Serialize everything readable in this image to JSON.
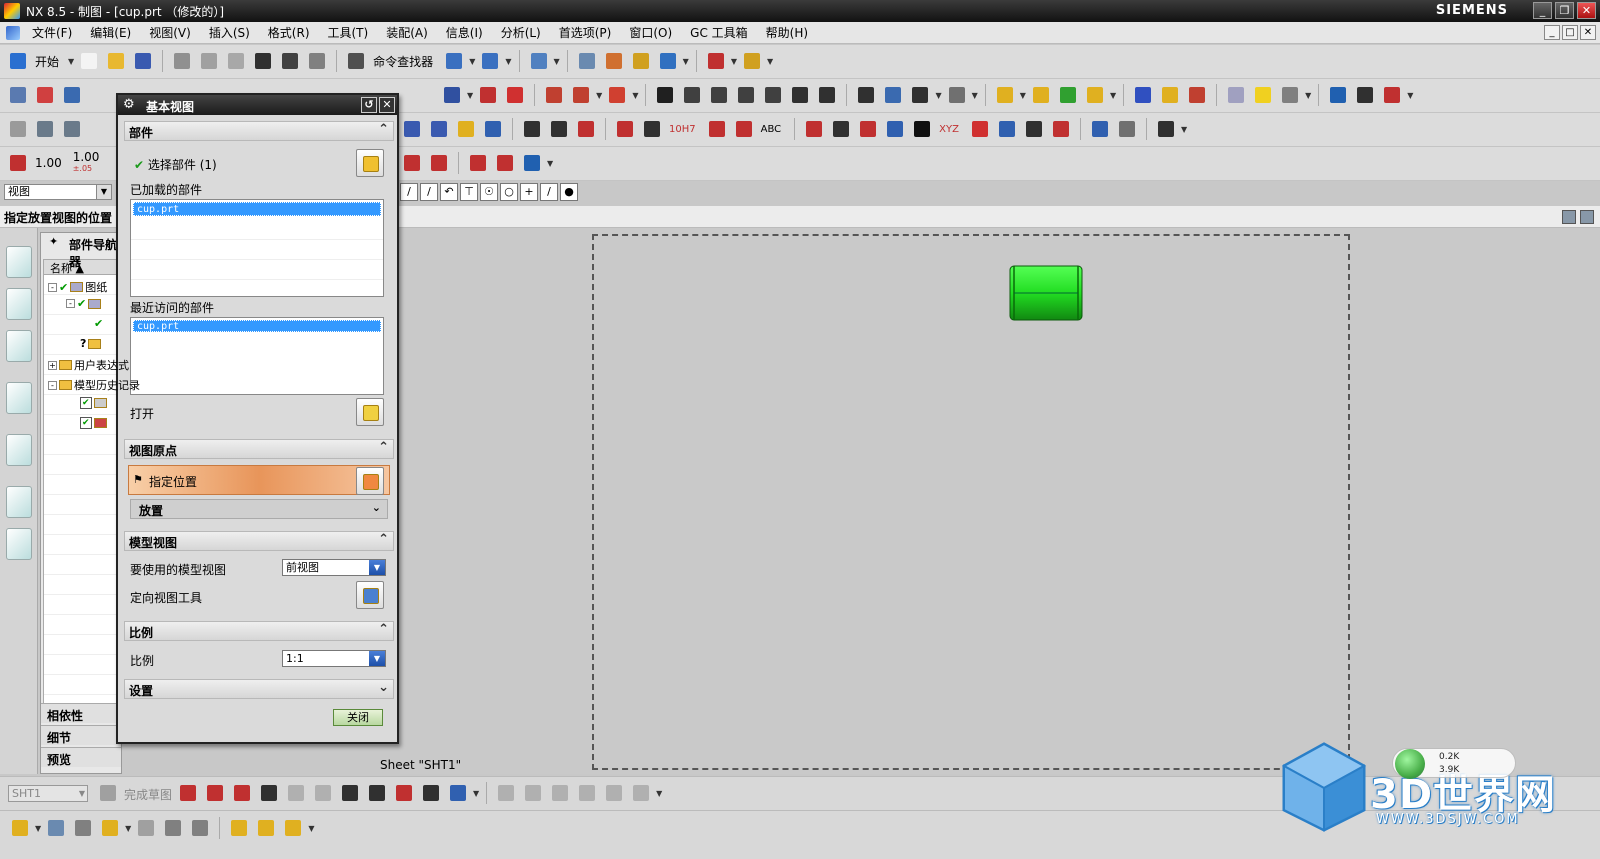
{
  "window": {
    "title": "NX 8.5 - 制图 - [cup.prt （修改的）]",
    "brand": "SIEMENS",
    "buttons": [
      "_",
      "❐",
      "✕"
    ]
  },
  "menubar": {
    "items": [
      "文件(F)",
      "编辑(E)",
      "视图(V)",
      "插入(S)",
      "格式(R)",
      "工具(T)",
      "装配(A)",
      "信息(I)",
      "分析(L)",
      "首选项(P)",
      "窗口(O)",
      "GC 工具箱",
      "帮助(H)"
    ]
  },
  "toolbar": {
    "start_label": "开始",
    "command_finder_label": "命令查找器",
    "scale_1": "1.00",
    "scale_2": "1.00",
    "scale_2_sub": "±.05",
    "abc_label": "ABC",
    "tol_label": "10H7",
    "xyz_label": "XYZ"
  },
  "selection_filter": {
    "value": "视图"
  },
  "hint": {
    "text": "指定放置视图的位置"
  },
  "part_navigator": {
    "title": "部件导航器",
    "column_name": "名称",
    "nodes": [
      "图纸",
      "用户表达式",
      "模型历史记录"
    ],
    "footer": [
      "相依性",
      "细节",
      "预览"
    ]
  },
  "dialog": {
    "title": "基本视图",
    "groups": {
      "part": {
        "header": "部件",
        "select_part": "选择部件 (1)",
        "loaded_label": "已加载的部件",
        "loaded_items": [
          "cup.prt"
        ],
        "recent_label": "最近访问的部件",
        "recent_items": [
          "cup.prt"
        ],
        "open_label": "打开"
      },
      "view_origin": {
        "header": "视图原点",
        "specify_location": "指定位置",
        "placement": "放置"
      },
      "model_view": {
        "header": "模型视图",
        "model_view_label": "要使用的模型视图",
        "model_view_value": "前视图",
        "orient_tool_label": "定向视图工具"
      },
      "scale": {
        "header": "比例",
        "scale_label": "比例",
        "scale_value": "1:1"
      },
      "settings": {
        "header": "设置"
      }
    },
    "close_label": "关闭"
  },
  "graphics": {
    "sheet_label": "Sheet \"SHT1\"",
    "cup_color": "#22dd22"
  },
  "bottom_toolbar": {
    "sheet_value": "SHT1",
    "finish_sketch": "完成草图"
  },
  "watermark": {
    "text": "3D世界网",
    "url": "WWW.3DSJW.COM"
  },
  "net_monitor": {
    "up": "0.2K",
    "down": "3.9K"
  }
}
